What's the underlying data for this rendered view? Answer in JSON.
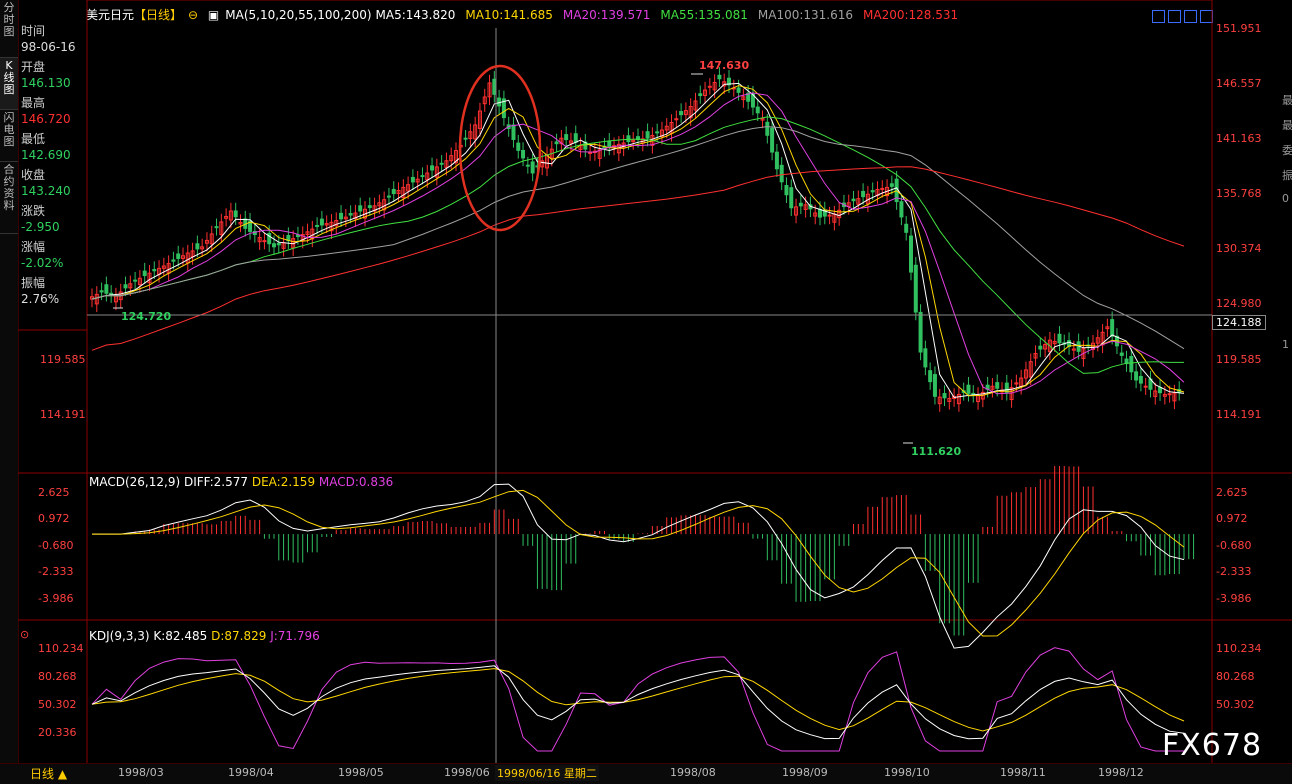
{
  "chart_title": "美元日元",
  "period_tag": "【日线】",
  "ma_header": {
    "label": "MA(5,10,20,55,100,200)",
    "items": [
      {
        "text": "MA5:143.820",
        "color": "#ffffff"
      },
      {
        "text": "MA10:141.685",
        "color": "#ffd700"
      },
      {
        "text": "MA20:139.571",
        "color": "#e040e0"
      },
      {
        "text": "MA55:135.081",
        "color": "#40e040"
      },
      {
        "text": "MA100:131.616",
        "color": "#a0a0a0"
      },
      {
        "text": "MA200:128.531",
        "color": "#ff3030"
      }
    ]
  },
  "left_tabs": [
    {
      "label": "分时图",
      "active": false
    },
    {
      "label": "K线图",
      "active": true
    },
    {
      "label": "闪电图",
      "active": false
    },
    {
      "label": "合约资料",
      "active": false
    }
  ],
  "info_panel": {
    "time_label": "时间",
    "time_value": "98-06-16",
    "open_label": "开盘",
    "open_value": "146.130",
    "high_label": "最高",
    "high_value": "146.720",
    "low_label": "最低",
    "low_value": "142.690",
    "close_label": "收盘",
    "close_value": "143.240",
    "change_label": "涨跌",
    "change_value": "-2.950",
    "pct_label": "涨幅",
    "pct_value": "-2.02%",
    "amp_label": "振幅",
    "amp_value": "2.76%"
  },
  "price_axis": {
    "right_labels": [
      "151.951",
      "146.557",
      "141.163",
      "135.768",
      "130.374",
      "124.980",
      "119.585",
      "114.191"
    ],
    "left_labels": [
      "119.585",
      "114.191"
    ],
    "crosshair_value": "124.188"
  },
  "price_annotations": {
    "high": "147.630",
    "low_a": "124.720",
    "low_b": "111.620"
  },
  "macd_header": {
    "label": "MACD(26,12,9)",
    "diff": "DIFF:2.577",
    "dea": "DEA:2.159",
    "macd": "MACD:0.836"
  },
  "macd_axis": [
    "2.625",
    "0.972",
    "-0.680",
    "-2.333",
    "-3.986"
  ],
  "kdj_header": {
    "label": "KDJ(9,3,3)",
    "k": "K:82.485",
    "d": "D:87.829",
    "j": "J:71.796"
  },
  "kdj_axis": [
    "110.234",
    "80.268",
    "50.302",
    "20.336"
  ],
  "x_axis": [
    "1998/03",
    "1998/04",
    "1998/05",
    "1998/06",
    "1998/08",
    "1998/09",
    "1998/10",
    "1998/11",
    "1998/12"
  ],
  "cursor_date": "1998/06/16 星期二",
  "bottom_tab": "日线 ▲",
  "watermark": "FX678",
  "colors": {
    "up": "#ff3030",
    "down": "#30c060",
    "grid": "#8b0000",
    "highlight": "#e03020"
  },
  "chart_data": {
    "type": "candlestick",
    "close_series": [
      125.5,
      126.2,
      125.8,
      127.0,
      127.8,
      128.5,
      129.2,
      130.0,
      130.6,
      132.5,
      134.1,
      132.4,
      131.5,
      130.6,
      131.2,
      131.8,
      132.6,
      133.0,
      133.5,
      134.1,
      134.6,
      135.5,
      136.4,
      137.2,
      138.1,
      139.0,
      140.5,
      142.5,
      146.6,
      143.2,
      140.0,
      137.8,
      139.6,
      141.2,
      140.8,
      139.8,
      140.2,
      140.6,
      141.0,
      141.2,
      142.0,
      143.1,
      144.3,
      145.9,
      147.0,
      146.1,
      144.8,
      143.1,
      138.2,
      134.4,
      134.7,
      133.5,
      133.8,
      134.9,
      135.5,
      136.2,
      136.5,
      132.0,
      120.3,
      116.0,
      115.8,
      116.4,
      116.1,
      117.0,
      116.4,
      117.8,
      120.2,
      121.5,
      121.1,
      120.4,
      121.2,
      122.8,
      120.0,
      117.6,
      116.7,
      116.2,
      116.4
    ]
  }
}
